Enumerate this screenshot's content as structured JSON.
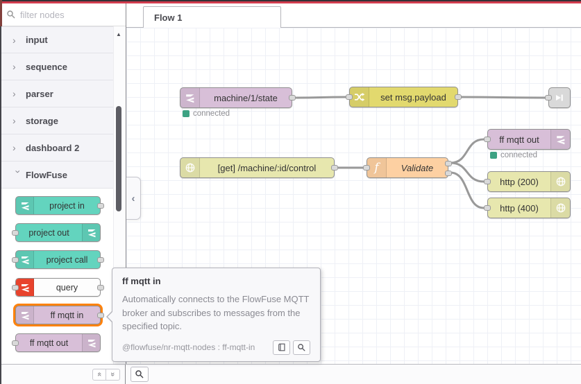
{
  "header": {
    "accent_dark": "#323236",
    "accent_red": "#d23c4e"
  },
  "palette": {
    "search": {
      "placeholder": "filter nodes"
    },
    "categories": [
      {
        "label": "input",
        "state": "collapsed"
      },
      {
        "label": "sequence",
        "state": "collapsed"
      },
      {
        "label": "parser",
        "state": "collapsed"
      },
      {
        "label": "storage",
        "state": "collapsed"
      },
      {
        "label": "dashboard 2",
        "state": "collapsed"
      },
      {
        "label": "FlowFuse",
        "state": "expanded"
      }
    ],
    "nodes": [
      {
        "label": "project in",
        "color": "#63d4be",
        "ports": "output-right",
        "icon": "flowfuse-icon"
      },
      {
        "label": "project out",
        "color": "#63d4be",
        "ports": "input-left",
        "icon": "flowfuse-icon"
      },
      {
        "label": "project call",
        "color": "#63d4be",
        "ports": "both",
        "icon": "flowfuse-icon"
      },
      {
        "label": "query",
        "color": "#fdfdfd",
        "ports": "both",
        "icon": "flowfuse-icon-red"
      },
      {
        "label": "ff mqtt in",
        "color": "#d8bfd8",
        "ports": "output-right",
        "icon": "flowfuse-icon",
        "hovered": true,
        "hover_border": "#ff820d"
      },
      {
        "label": "ff mqtt out",
        "color": "#d8bfd8",
        "ports": "input-left",
        "icon": "flowfuse-icon"
      }
    ]
  },
  "workspace": {
    "tab_label": "Flow 1",
    "wire_color": "#999999",
    "status_color": "#3da283",
    "flow_nodes": [
      {
        "label": "machine/1/state",
        "type": "ff-mqtt-in",
        "color": "#d8bfd8",
        "status": "connected"
      },
      {
        "label": "set msg.payload",
        "type": "change",
        "color": "#e2d96e"
      },
      {
        "label": "",
        "type": "link-out",
        "color": "#d9d9d9"
      },
      {
        "label": "[get] /machine/:id/control",
        "type": "http-in",
        "color": "#e7e7ae"
      },
      {
        "label": "Validate",
        "type": "function",
        "color": "#fdd0a2"
      },
      {
        "label": "ff mqtt out",
        "type": "ff-mqtt-out",
        "color": "#d8bfd8",
        "status": "connected"
      },
      {
        "label": "http (200)",
        "type": "http-response",
        "color": "#e7e7ae"
      },
      {
        "label": "http (400)",
        "type": "http-response",
        "color": "#e7e7ae"
      }
    ]
  },
  "tooltip": {
    "title": "ff mqtt in",
    "description": "Automatically connects to the FlowFuse MQTT broker and subscribes to messages from the specified topic.",
    "module": "@flowfuse/nr-mqtt-nodes : ff-mqtt-in"
  }
}
